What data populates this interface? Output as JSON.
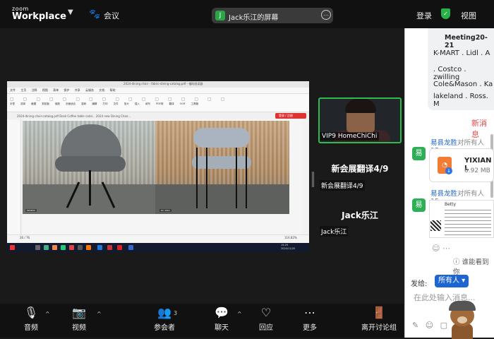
{
  "app": {
    "brand_small": "zoom",
    "brand_big": "Workplace",
    "meeting_label": "会议"
  },
  "share": {
    "j_icon": "J",
    "label": "Jack乐江的屏幕"
  },
  "header": {
    "login": "登录",
    "view": "视图"
  },
  "shared_screen": {
    "window_title": "2024-dining chair - fabric-dining-catalog.pdf - 福昕阅读器",
    "menu": [
      "文件",
      "主页",
      "注释",
      "视图",
      "表单",
      "保护",
      "共享",
      "云服务",
      "文档",
      "帮助"
    ],
    "tools": [
      "手型",
      "选择",
      "截图",
      "剪贴板",
      "缩放",
      "页面适合",
      "旋转",
      "编辑",
      "打印",
      "文件",
      "放大",
      "插入",
      "填写",
      "PDF转",
      "翻译",
      "OCR",
      "工具箱"
    ],
    "red_button": "登录 / 注册",
    "tabs": "2024-dining chair-catalog.pdf   Desk Coffee table catal...   2024 new Dining Chair...",
    "photo1_label": "PR4650",
    "photo2_label": "DC 2901",
    "status_page": "26 / 76",
    "zoom": "116.82%",
    "clock_time": "15:29",
    "clock_date": "2024/11/20"
  },
  "participants": [
    {
      "name": "VIP9 HomeChiChi"
    },
    {
      "display": "新会展翻译4/9",
      "name": "新会展翻译4/9"
    },
    {
      "display": "Jack乐江",
      "name": "Jack乐江"
    }
  ],
  "toolbar": {
    "audio": "音频",
    "video": "视频",
    "participants": "参会者",
    "participants_count": "3",
    "chat": "聊天",
    "react": "回应",
    "more": "更多",
    "leave": "离开讨论组"
  },
  "chat": {
    "card_title": "Meeting20-21",
    "card_lines": [
      "K-MART . Lidl . A",
      ". Costco . zwilling",
      "Cole&Mason . Ka",
      "lakeland . Ross. M"
    ],
    "new_messages": "新消息",
    "messages": [
      {
        "avatar": "易",
        "sender": "易县龙胜",
        "to": "对所有人",
        "time": "15"
      },
      {
        "avatar": "易",
        "sender": "易县龙胜",
        "to": "对所有人",
        "time": "15"
      }
    ],
    "file": {
      "name": "YIXIAN L",
      "size": "6.92 MB"
    },
    "bizcard_name": "Betty",
    "who_can_see": "谁能看到你",
    "send_to_label": "发给:",
    "send_to_value": "所有人",
    "placeholder": "在此处输入消息..."
  },
  "colors": {
    "accent_green": "#2fbc4f",
    "link_blue": "#1d66d2",
    "alert_red": "#e84949"
  }
}
